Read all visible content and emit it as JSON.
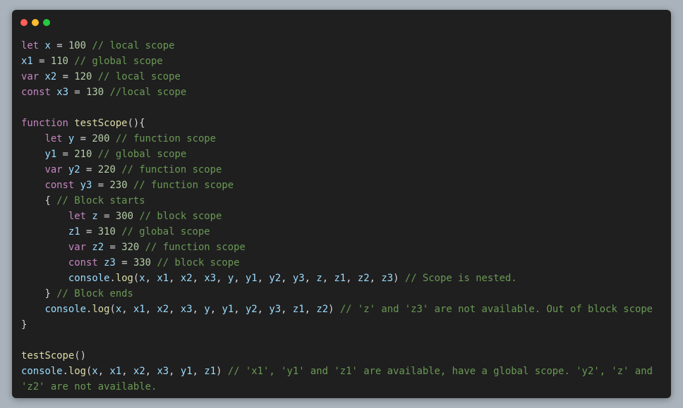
{
  "window": {
    "colors": {
      "background": "#1f1f1f",
      "close": "#ff5f56",
      "minimize": "#ffbd2e",
      "maximize": "#27c93f"
    }
  },
  "token_colors": {
    "kw": "#c586c0",
    "var": "#9cdcfe",
    "num": "#b5cea8",
    "cmt": "#6a9955",
    "fn": "#dcdcaa",
    "pun": "#d4d4d4"
  },
  "code": {
    "lines": [
      [
        [
          "kw",
          "let"
        ],
        [
          "pun",
          " "
        ],
        [
          "var",
          "x"
        ],
        [
          "pun",
          " = "
        ],
        [
          "num",
          "100"
        ],
        [
          "pun",
          " "
        ],
        [
          "cmt",
          "// local scope"
        ]
      ],
      [
        [
          "var",
          "x1"
        ],
        [
          "pun",
          " = "
        ],
        [
          "num",
          "110"
        ],
        [
          "pun",
          " "
        ],
        [
          "cmt",
          "// global scope"
        ]
      ],
      [
        [
          "kw",
          "var"
        ],
        [
          "pun",
          " "
        ],
        [
          "var",
          "x2"
        ],
        [
          "pun",
          " = "
        ],
        [
          "num",
          "120"
        ],
        [
          "pun",
          " "
        ],
        [
          "cmt",
          "// local scope"
        ]
      ],
      [
        [
          "kw",
          "const"
        ],
        [
          "pun",
          " "
        ],
        [
          "var",
          "x3"
        ],
        [
          "pun",
          " = "
        ],
        [
          "num",
          "130"
        ],
        [
          "pun",
          " "
        ],
        [
          "cmt",
          "//local scope"
        ]
      ],
      [],
      [
        [
          "kw",
          "function"
        ],
        [
          "pun",
          " "
        ],
        [
          "fn",
          "testScope"
        ],
        [
          "pun",
          "(){"
        ]
      ],
      [
        [
          "pun",
          "    "
        ],
        [
          "kw",
          "let"
        ],
        [
          "pun",
          " "
        ],
        [
          "var",
          "y"
        ],
        [
          "pun",
          " = "
        ],
        [
          "num",
          "200"
        ],
        [
          "pun",
          " "
        ],
        [
          "cmt",
          "// function scope"
        ]
      ],
      [
        [
          "pun",
          "    "
        ],
        [
          "var",
          "y1"
        ],
        [
          "pun",
          " = "
        ],
        [
          "num",
          "210"
        ],
        [
          "pun",
          " "
        ],
        [
          "cmt",
          "// global scope"
        ]
      ],
      [
        [
          "pun",
          "    "
        ],
        [
          "kw",
          "var"
        ],
        [
          "pun",
          " "
        ],
        [
          "var",
          "y2"
        ],
        [
          "pun",
          " = "
        ],
        [
          "num",
          "220"
        ],
        [
          "pun",
          " "
        ],
        [
          "cmt",
          "// function scope"
        ]
      ],
      [
        [
          "pun",
          "    "
        ],
        [
          "kw",
          "const"
        ],
        [
          "pun",
          " "
        ],
        [
          "var",
          "y3"
        ],
        [
          "pun",
          " = "
        ],
        [
          "num",
          "230"
        ],
        [
          "pun",
          " "
        ],
        [
          "cmt",
          "// function scope"
        ]
      ],
      [
        [
          "pun",
          "    { "
        ],
        [
          "cmt",
          "// Block starts"
        ]
      ],
      [
        [
          "pun",
          "        "
        ],
        [
          "kw",
          "let"
        ],
        [
          "pun",
          " "
        ],
        [
          "var",
          "z"
        ],
        [
          "pun",
          " = "
        ],
        [
          "num",
          "300"
        ],
        [
          "pun",
          " "
        ],
        [
          "cmt",
          "// block scope"
        ]
      ],
      [
        [
          "pun",
          "        "
        ],
        [
          "var",
          "z1"
        ],
        [
          "pun",
          " = "
        ],
        [
          "num",
          "310"
        ],
        [
          "pun",
          " "
        ],
        [
          "cmt",
          "// global scope"
        ]
      ],
      [
        [
          "pun",
          "        "
        ],
        [
          "kw",
          "var"
        ],
        [
          "pun",
          " "
        ],
        [
          "var",
          "z2"
        ],
        [
          "pun",
          " = "
        ],
        [
          "num",
          "320"
        ],
        [
          "pun",
          " "
        ],
        [
          "cmt",
          "// function scope"
        ]
      ],
      [
        [
          "pun",
          "        "
        ],
        [
          "kw",
          "const"
        ],
        [
          "pun",
          " "
        ],
        [
          "var",
          "z3"
        ],
        [
          "pun",
          " = "
        ],
        [
          "num",
          "330"
        ],
        [
          "pun",
          " "
        ],
        [
          "cmt",
          "// block scope"
        ]
      ],
      [
        [
          "pun",
          "        "
        ],
        [
          "var",
          "console"
        ],
        [
          "pun",
          "."
        ],
        [
          "fn",
          "log"
        ],
        [
          "pun",
          "("
        ],
        [
          "var",
          "x"
        ],
        [
          "pun",
          ", "
        ],
        [
          "var",
          "x1"
        ],
        [
          "pun",
          ", "
        ],
        [
          "var",
          "x2"
        ],
        [
          "pun",
          ", "
        ],
        [
          "var",
          "x3"
        ],
        [
          "pun",
          ", "
        ],
        [
          "var",
          "y"
        ],
        [
          "pun",
          ", "
        ],
        [
          "var",
          "y1"
        ],
        [
          "pun",
          ", "
        ],
        [
          "var",
          "y2"
        ],
        [
          "pun",
          ", "
        ],
        [
          "var",
          "y3"
        ],
        [
          "pun",
          ", "
        ],
        [
          "var",
          "z"
        ],
        [
          "pun",
          ", "
        ],
        [
          "var",
          "z1"
        ],
        [
          "pun",
          ", "
        ],
        [
          "var",
          "z2"
        ],
        [
          "pun",
          ", "
        ],
        [
          "var",
          "z3"
        ],
        [
          "pun",
          ") "
        ],
        [
          "cmt",
          "// Scope is nested."
        ]
      ],
      [
        [
          "pun",
          "    } "
        ],
        [
          "cmt",
          "// Block ends"
        ]
      ],
      [
        [
          "pun",
          "    "
        ],
        [
          "var",
          "console"
        ],
        [
          "pun",
          "."
        ],
        [
          "fn",
          "log"
        ],
        [
          "pun",
          "("
        ],
        [
          "var",
          "x"
        ],
        [
          "pun",
          ", "
        ],
        [
          "var",
          "x1"
        ],
        [
          "pun",
          ", "
        ],
        [
          "var",
          "x2"
        ],
        [
          "pun",
          ", "
        ],
        [
          "var",
          "x3"
        ],
        [
          "pun",
          ", "
        ],
        [
          "var",
          "y"
        ],
        [
          "pun",
          ", "
        ],
        [
          "var",
          "y1"
        ],
        [
          "pun",
          ", "
        ],
        [
          "var",
          "y2"
        ],
        [
          "pun",
          ", "
        ],
        [
          "var",
          "y3"
        ],
        [
          "pun",
          ", "
        ],
        [
          "var",
          "z1"
        ],
        [
          "pun",
          ", "
        ],
        [
          "var",
          "z2"
        ],
        [
          "pun",
          ") "
        ],
        [
          "cmt",
          "// 'z' and 'z3' are not available. Out of block scope"
        ]
      ],
      [
        [
          "pun",
          "}"
        ]
      ],
      [],
      [
        [
          "fn",
          "testScope"
        ],
        [
          "pun",
          "()"
        ]
      ],
      [
        [
          "var",
          "console"
        ],
        [
          "pun",
          "."
        ],
        [
          "fn",
          "log"
        ],
        [
          "pun",
          "("
        ],
        [
          "var",
          "x"
        ],
        [
          "pun",
          ", "
        ],
        [
          "var",
          "x1"
        ],
        [
          "pun",
          ", "
        ],
        [
          "var",
          "x2"
        ],
        [
          "pun",
          ", "
        ],
        [
          "var",
          "x3"
        ],
        [
          "pun",
          ", "
        ],
        [
          "var",
          "y1"
        ],
        [
          "pun",
          ", "
        ],
        [
          "var",
          "z1"
        ],
        [
          "pun",
          ") "
        ],
        [
          "cmt",
          "// 'x1', 'y1' and 'z1' are available, have a global scope. 'y2', 'z' and"
        ]
      ],
      [
        [
          "cmt",
          "'z2' are not available."
        ]
      ]
    ]
  }
}
